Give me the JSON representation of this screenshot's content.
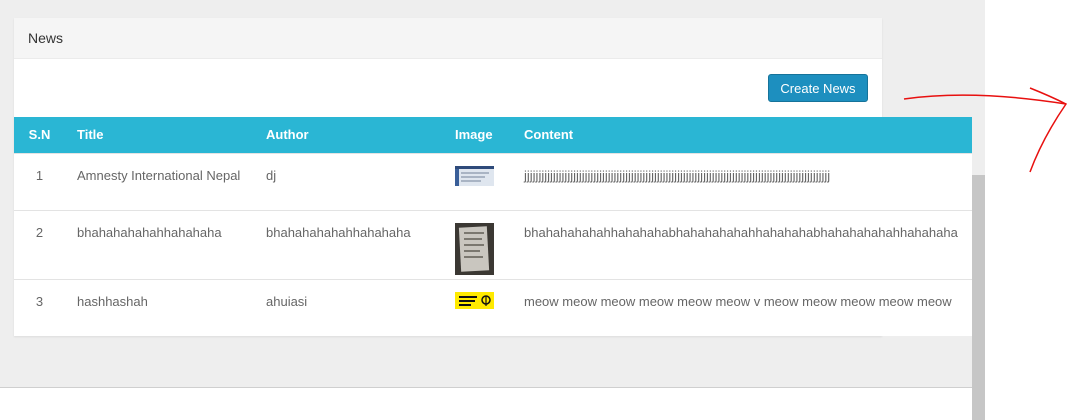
{
  "panel": {
    "title": "News",
    "create_button": "Create News"
  },
  "table": {
    "headers": [
      "S.N",
      "Title",
      "Author",
      "Image",
      "Content"
    ],
    "rows": [
      {
        "sn": "1",
        "title": "Amnesty International Nepal",
        "author": "dj",
        "image": "screenshot-thumbnail",
        "content": "jjjjjjjjjjjjjjjjjjjjjjjjjjjjjjjjjjjjjjjjjjjjjjjjjjjjjjjjjjjjjjjjjjjjjjjjjjjjjjjjjjjjjjjjjjjjjjjjjjjjjjjjjj"
      },
      {
        "sn": "2",
        "title": "bhahahahahahhahahaha",
        "author": "bhahahahahahhahahaha",
        "image": "document-photo-thumbnail",
        "content": "bhahahahahahhahahahabhahahahahahhahahahabhahahahahahhahahaha"
      },
      {
        "sn": "3",
        "title": "hashhashah",
        "author": "ahuiasi",
        "image": "amnesty-logo-thumbnail",
        "content": "meow meow meow meow meow meow v meow meow meow meow meow"
      }
    ]
  },
  "colors": {
    "header_bg": "#2ab6d4",
    "button_bg": "#1d8fbf",
    "annotation": "#e8100f"
  }
}
